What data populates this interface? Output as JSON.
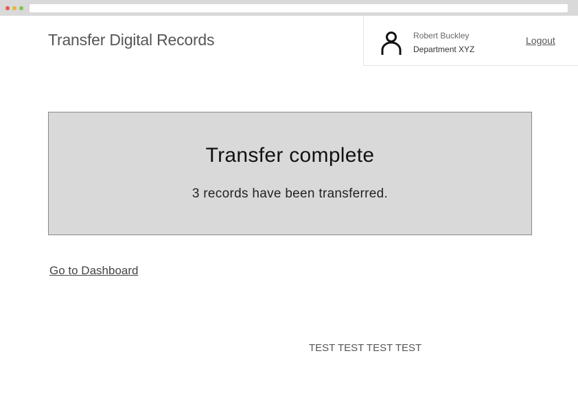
{
  "header": {
    "title": "Transfer Digital Records"
  },
  "user": {
    "name": "Robert Buckley",
    "department": "Department XYZ",
    "icon": "user-icon",
    "logout_label": "Logout"
  },
  "confirmation": {
    "heading": "Transfer complete",
    "message": "3 records have been transferred."
  },
  "links": {
    "dashboard_label": "Go to Dashboard"
  },
  "footer": {
    "test_text": "TEST TEST TEST TEST"
  },
  "colors": {
    "panel_background": "#d9d9d9",
    "panel_border": "#888888",
    "browser_chrome": "#d9d9d9"
  }
}
